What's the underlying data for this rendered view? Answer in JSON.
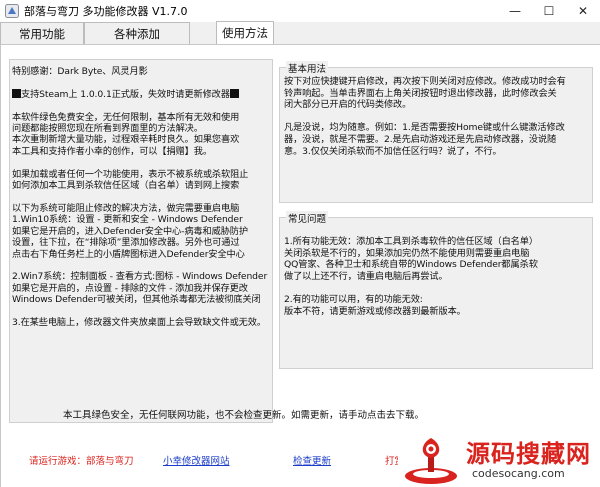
{
  "window": {
    "title": "部落与弯刀  多功能修改器  V1.7.0",
    "minimize": "—",
    "maximize": "☐",
    "close": "✕"
  },
  "tabs": [
    {
      "label": "常用功能"
    },
    {
      "label": "各种添加"
    },
    {
      "label": "使用方法",
      "active": true
    }
  ],
  "left_panel": {
    "lines": [
      "特别感谢：Dark Byte、风灵月影",
      "",
      "支持Steam上 1.0.0.1正式版，失效时请更新修改器",
      "",
      "本软件绿色免费安全，无任何限制，基本所有无效和使用",
      "问题都能按照您现在所看到界面里的方法解决。",
      "本次重制新增大量功能，过程艰辛耗时良久。如果您喜欢",
      "本工具和支持作者小幸的创作，可以【捐赠】我。",
      "",
      "如果加载或者任何一个功能使用，表示不被系统或杀软阻止",
      "如何添加本工具到杀软信任区域（白名单）请到网上搜索",
      "",
      "以下为系统可能阻止修改的解决方法，做完需要重启电脑",
      "1.Win10系统：设置 - 更新和安全 - Windows Defender",
      "  如果它是开启的，进入Defender安全中心-病毒和威胁防护",
      "  设置，往下拉，在“排除项”里添加修改器。另外也可通过",
      "  点击右下角任务栏上的小盾牌图标进入Defender安全中心",
      "",
      "2.Win7系统：控制面板 - 查看方式:图标 - Windows Defender",
      "  如果它是开启的，点设置 - 排除的文件 - 添加我并保存更改",
      "  Windows Defender可被关闭，但其他杀毒都无法被彻底关闭",
      "",
      "3.在某些电脑上，修改器文件夹放桌面上会导致缺文件或无效。"
    ]
  },
  "basic_usage": {
    "title": "基本用法",
    "lines": [
      "按下对应快捷键开启修改，再次按下则关闭对应修改。修改成功时会有",
      "铃声响起。当单击界面右上角关闭按钮时退出修改器，此时修改会关",
      "闭大部分已开启的代码类修改。",
      "",
      "凡是没说，均为随意。例如：1.是否需要按Home键或什么键激活修改",
      "器，没说，就是不需要。2.是先启动游戏还是先启动修改器，没说随",
      "意。3.仅仅关闭杀软而不加信任区行吗？说了，不行。"
    ]
  },
  "faq": {
    "title": "常见问题",
    "lines": [
      "1.所有功能无效：添加本工具到杀毒软件的信任区域（白名单）",
      "  关闭杀软是不行的，如果添加完仍然不能使用则需要重启电脑",
      "  QQ管家、各种卫士和系统自带的Windows Defender都属杀软",
      "  做了以上还不行，请重启电脑后再尝试。",
      "",
      "2.有的功能可以用，有的功能无效:",
      "  版本不符，请更新游戏或修改器到最新版本。"
    ]
  },
  "footer": {
    "notice": "本工具绿色安全，无任何联网功能，也不会检查更新。如需更新，请手动点击去下载。",
    "link_game": "请运行游戏：部落与弯刀",
    "link_site": "小幸修改器网站",
    "link_update": "检查更新",
    "link_donate": "打赏"
  },
  "watermark": {
    "name": "源码搜藏网",
    "url": "codesocang.com"
  },
  "colors": {
    "accent_red": "#d9231e",
    "link_blue": "#1a3cc8",
    "panel_bg": "#f0f0f0"
  }
}
